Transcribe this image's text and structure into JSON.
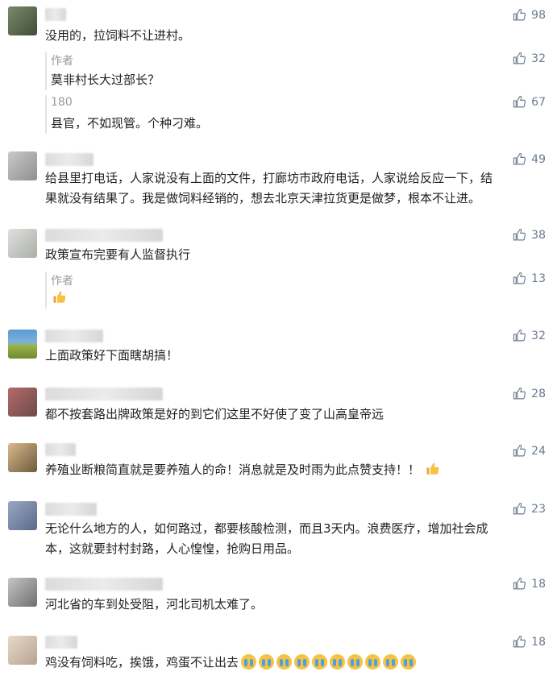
{
  "comments": [
    {
      "text": "没用的，拉饲料不让进村。",
      "likes": "98"
    },
    {
      "text": "给县里打电话，人家说没有上面的文件，打廊坊市政府电话，人家说给反应一下，结果就没有结果了。我是做饲料经销的，想去北京天津拉货更是做梦，根本不让进。",
      "likes": "49"
    },
    {
      "text": "政策宣布完要有人监督执行",
      "likes": "38"
    },
    {
      "text": "上面政策好下面瞎胡搞！",
      "likes": "32"
    },
    {
      "text": "都不按套路出牌政策是好的到它们这里不好使了变了山高皇帝远",
      "likes": "28"
    },
    {
      "text": "养殖业断粮简直就是要养殖人的命！消息就是及时雨为此点赞支持！！",
      "likes": "24"
    },
    {
      "text": "无论什么地方的人，如何路过，都要核酸检测，而且3天内。浪费医疗，增加社会成本，这就要封村封路，人心惶惶，抢购日用品。",
      "likes": "23"
    },
    {
      "text": "河北省的车到处受阻，河北司机太难了。",
      "likes": "18"
    },
    {
      "text": "鸡没有饲料吃，挨饿，鸡蛋不让出去",
      "likes": "18"
    }
  ],
  "replies": [
    {
      "name": "作者",
      "text": "莫非村长大过部长？",
      "likes": "32"
    },
    {
      "name": "180",
      "text": "县官，不如现管。个种刁难。",
      "likes": "67"
    },
    {
      "name": "作者",
      "text": "",
      "likes": "13"
    }
  ],
  "icons": {
    "like": "thumbs-up-icon",
    "emoji_like": "thumbs-up-emoji",
    "emoji_cry": "crying-face-emoji"
  },
  "colors": {
    "like": "#6d7a8f",
    "reply_name": "#9a9a9a",
    "text": "#222222"
  }
}
